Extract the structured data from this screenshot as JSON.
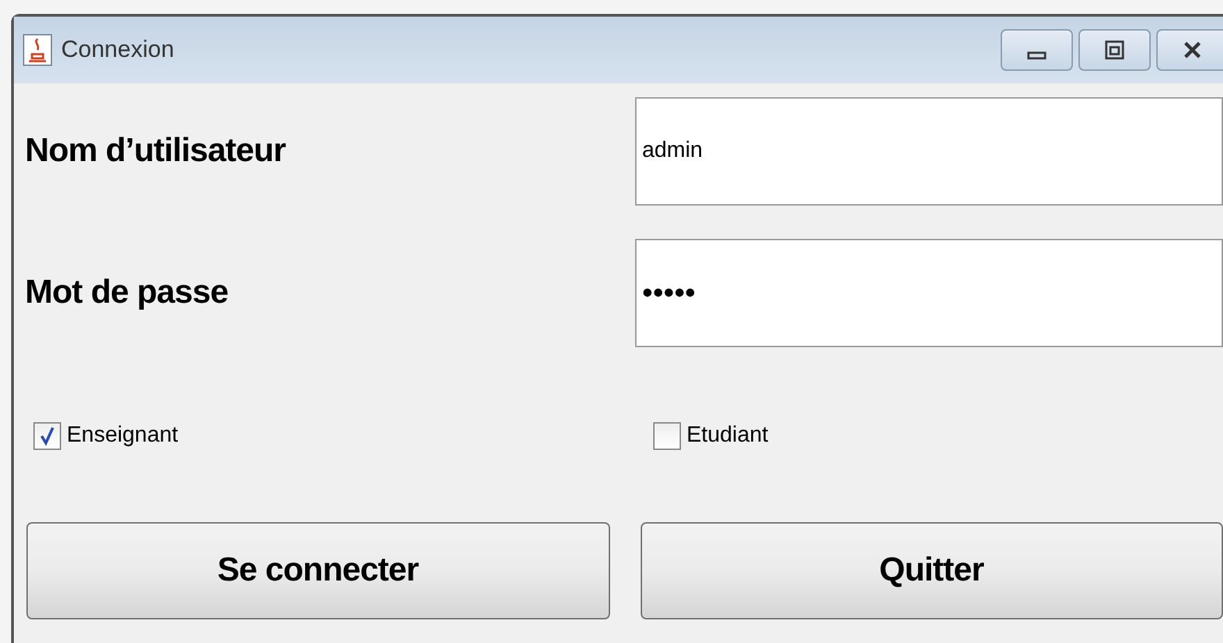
{
  "window": {
    "title": "Connexion"
  },
  "fields": [
    {
      "label": "Nom d’utilisateur",
      "value": "admin"
    },
    {
      "label": "Mot de passe",
      "value": "•••••"
    }
  ],
  "checkboxes": [
    {
      "label": "Enseignant",
      "checked": true
    },
    {
      "label": "Etudiant",
      "checked": false
    }
  ],
  "buttons": [
    "Se connecter",
    "Quitter"
  ]
}
